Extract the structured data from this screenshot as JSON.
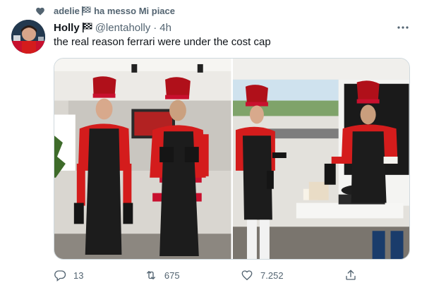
{
  "social_context": {
    "text_user": "adelie",
    "text_action": "ha messo Mi piace",
    "icon": "heart-icon"
  },
  "author": {
    "name": "Holly",
    "handle": "@lentaholly",
    "separator": "·",
    "time": "4h",
    "badge_icon": "checkered-flag-icon",
    "avatar_icon": "avatar"
  },
  "tweet": {
    "text": "the real reason ferrari were under the cost cap"
  },
  "media": {
    "photos": [
      {
        "name": "photo-two-chefs-in-hats"
      },
      {
        "name": "photo-cooking-pancakes"
      }
    ]
  },
  "actions": {
    "reply_count": "13",
    "retweet_count": "675",
    "like_count": "7.252",
    "reply_icon": "reply-icon",
    "retweet_icon": "retweet-icon",
    "like_icon": "heart-outline-icon",
    "share_icon": "share-icon",
    "more_icon": "more-dots-icon"
  },
  "colors": {
    "text_primary": "#0f1419",
    "text_secondary": "#536471",
    "border": "#cfd9de",
    "ferrari_red": "#d41c1c"
  }
}
